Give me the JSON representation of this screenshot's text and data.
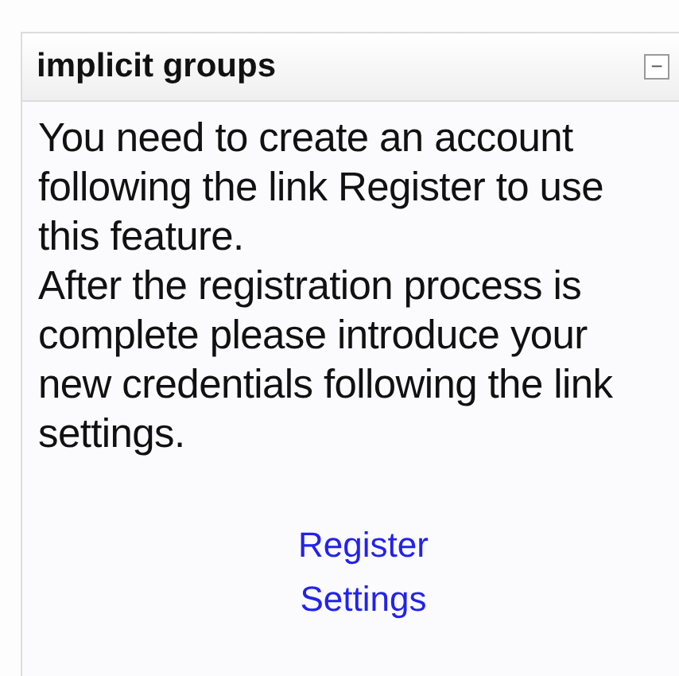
{
  "block": {
    "title": "implicit groups",
    "collapse_icon": "−",
    "paragraphs": [
      "You need to create an account following the link Register to use this feature.",
      "After the registration process is complete please introduce your new credentials following the link settings."
    ],
    "links": [
      "Register",
      "Settings"
    ]
  }
}
